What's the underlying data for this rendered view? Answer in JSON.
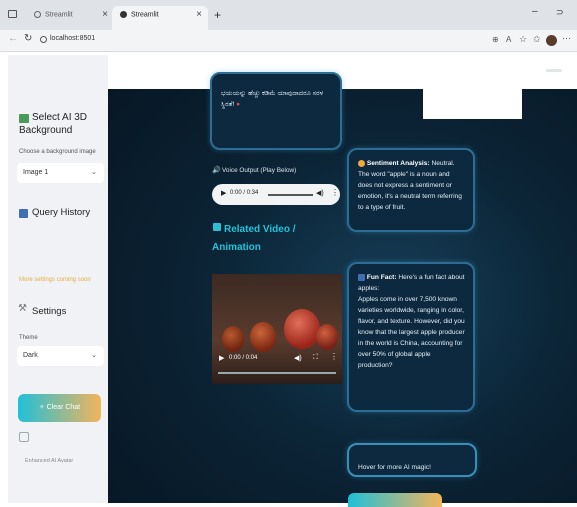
{
  "browser": {
    "tabs": [
      {
        "label": "Streamlit"
      },
      {
        "label": "Streamlit"
      }
    ],
    "url": "localhost:8501"
  },
  "sidebar": {
    "bg_title": "Select AI 3D Background",
    "bg_label": "Choose a background image",
    "bg_value": "Image 1",
    "history_title": "Query History",
    "more_settings": "More settings coming soon",
    "settings_title": "Settings",
    "theme_label": "Theme",
    "theme_value": "Dark",
    "clear_button": "Clear Chat",
    "footer": "Enhanced AI Avatar"
  },
  "main": {
    "response_text": "ಭಯಯನ್ನು ಹೆಚ್ಚು ಕಡಿಮೆ ಯಾವುದಾದರೂ ಸರಳ ಸ್ಥಿರತೆ!",
    "voice_label": "Voice Output (Play Below)",
    "audio_time": "0:00 / 0:34",
    "video_heading": "Related Video / Animation",
    "video_time": "0:00 / 0:04",
    "sentiment": {
      "label": "Sentiment Analysis:",
      "text": "Neutral. The word \"apple\" is a noun and does not express a sentiment or emotion, it's a neutral term referring to a type of fruit."
    },
    "funfact": {
      "label": "Fun Fact:",
      "text1": "Here's a fun fact about apples:",
      "text2": "Apples come in over 7,500 known varieties worldwide, ranging in color, flavor, and texture. However, did you know that the largest apple producer in the world is China, accounting for over 50% of global apple production?"
    },
    "hover_text": "Hover for more AI magic!"
  },
  "colors": {
    "accent_cyan": "#20c0d8",
    "accent_orange": "#f3b45a",
    "card_border": "#2d6d93"
  }
}
